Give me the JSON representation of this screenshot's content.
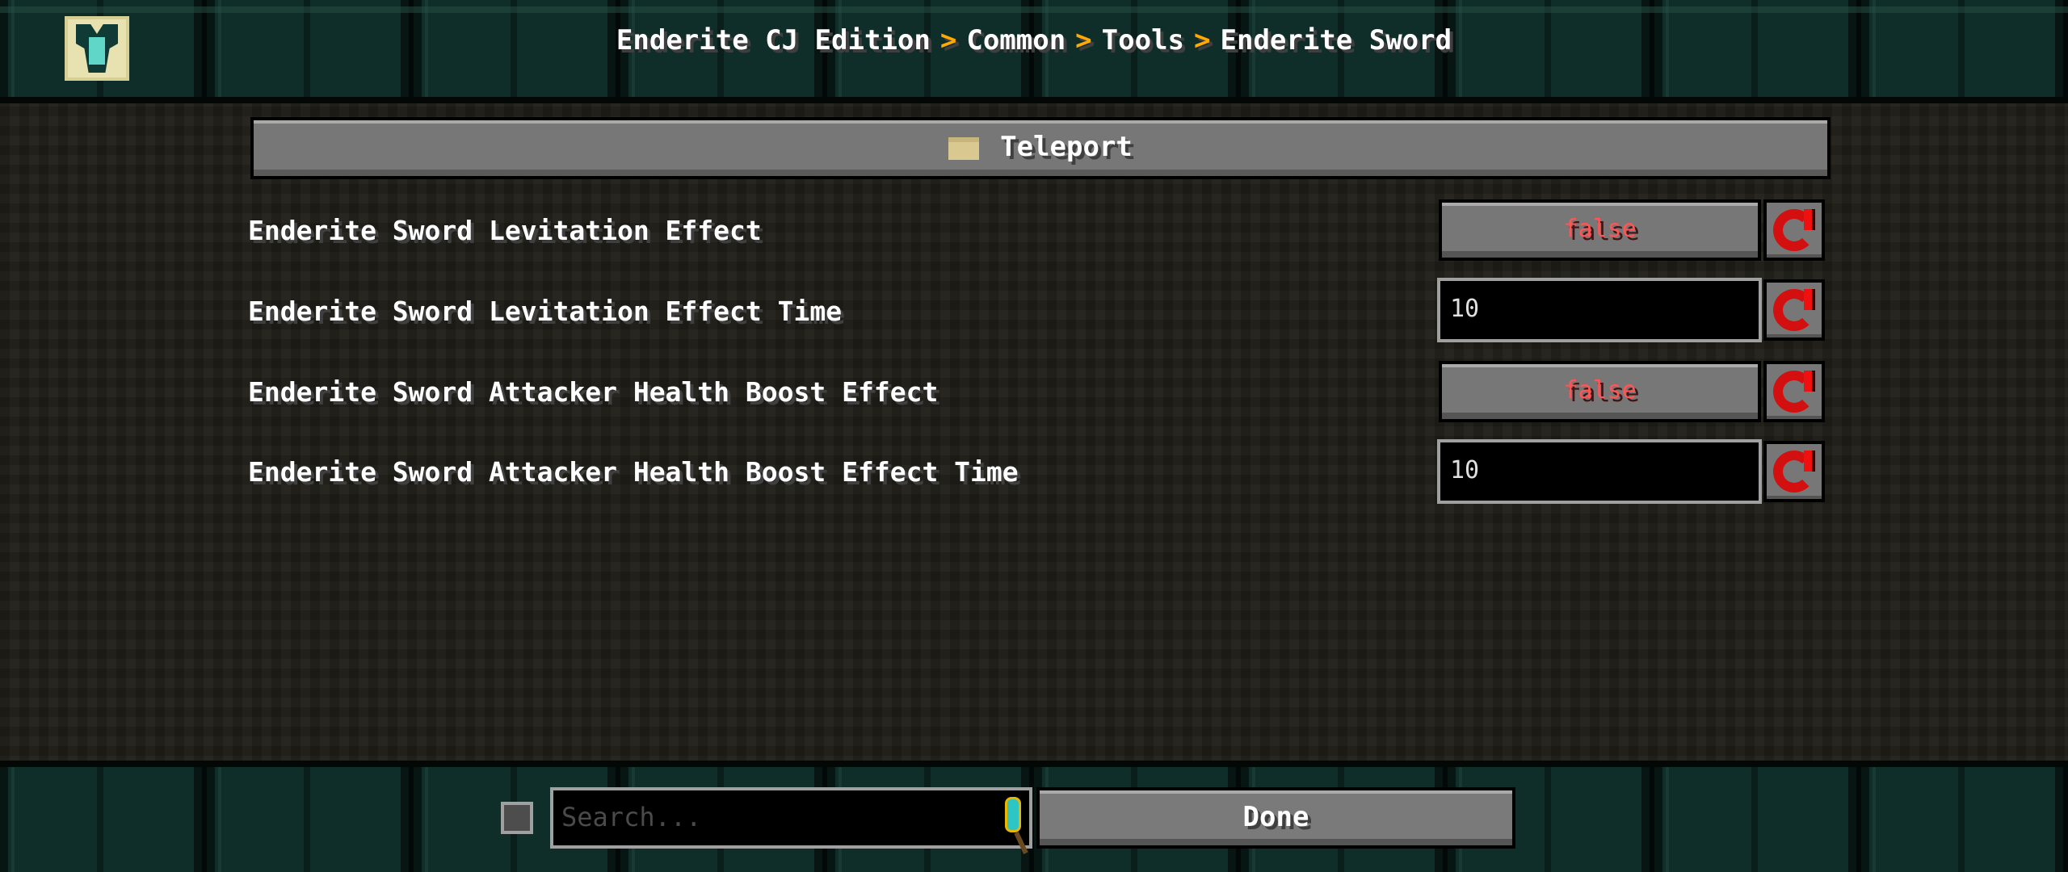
{
  "header": {
    "logo": "enderite-chestplate-icon",
    "breadcrumb": [
      "Enderite CJ Edition",
      "Common",
      "Tools",
      "Enderite Sword"
    ],
    "separator": ">"
  },
  "section": {
    "icon": "folder-icon",
    "title": "Teleport"
  },
  "settings": [
    {
      "label": "Enderite Sword Levitation Effect",
      "type": "toggle",
      "value": "false"
    },
    {
      "label": "Enderite Sword Levitation Effect Time",
      "type": "text",
      "value": "10"
    },
    {
      "label": "Enderite Sword Attacker Health Boost Effect",
      "type": "toggle",
      "value": "false"
    },
    {
      "label": "Enderite Sword Attacker Health Boost Effect Time",
      "type": "text",
      "value": "10"
    }
  ],
  "footer": {
    "search_placeholder": "Search...",
    "done_label": "Done",
    "search_icon": "magnifier-icon"
  },
  "colors": {
    "false_text": "#ff5555",
    "breadcrumb_separator": "#ffaa00"
  }
}
